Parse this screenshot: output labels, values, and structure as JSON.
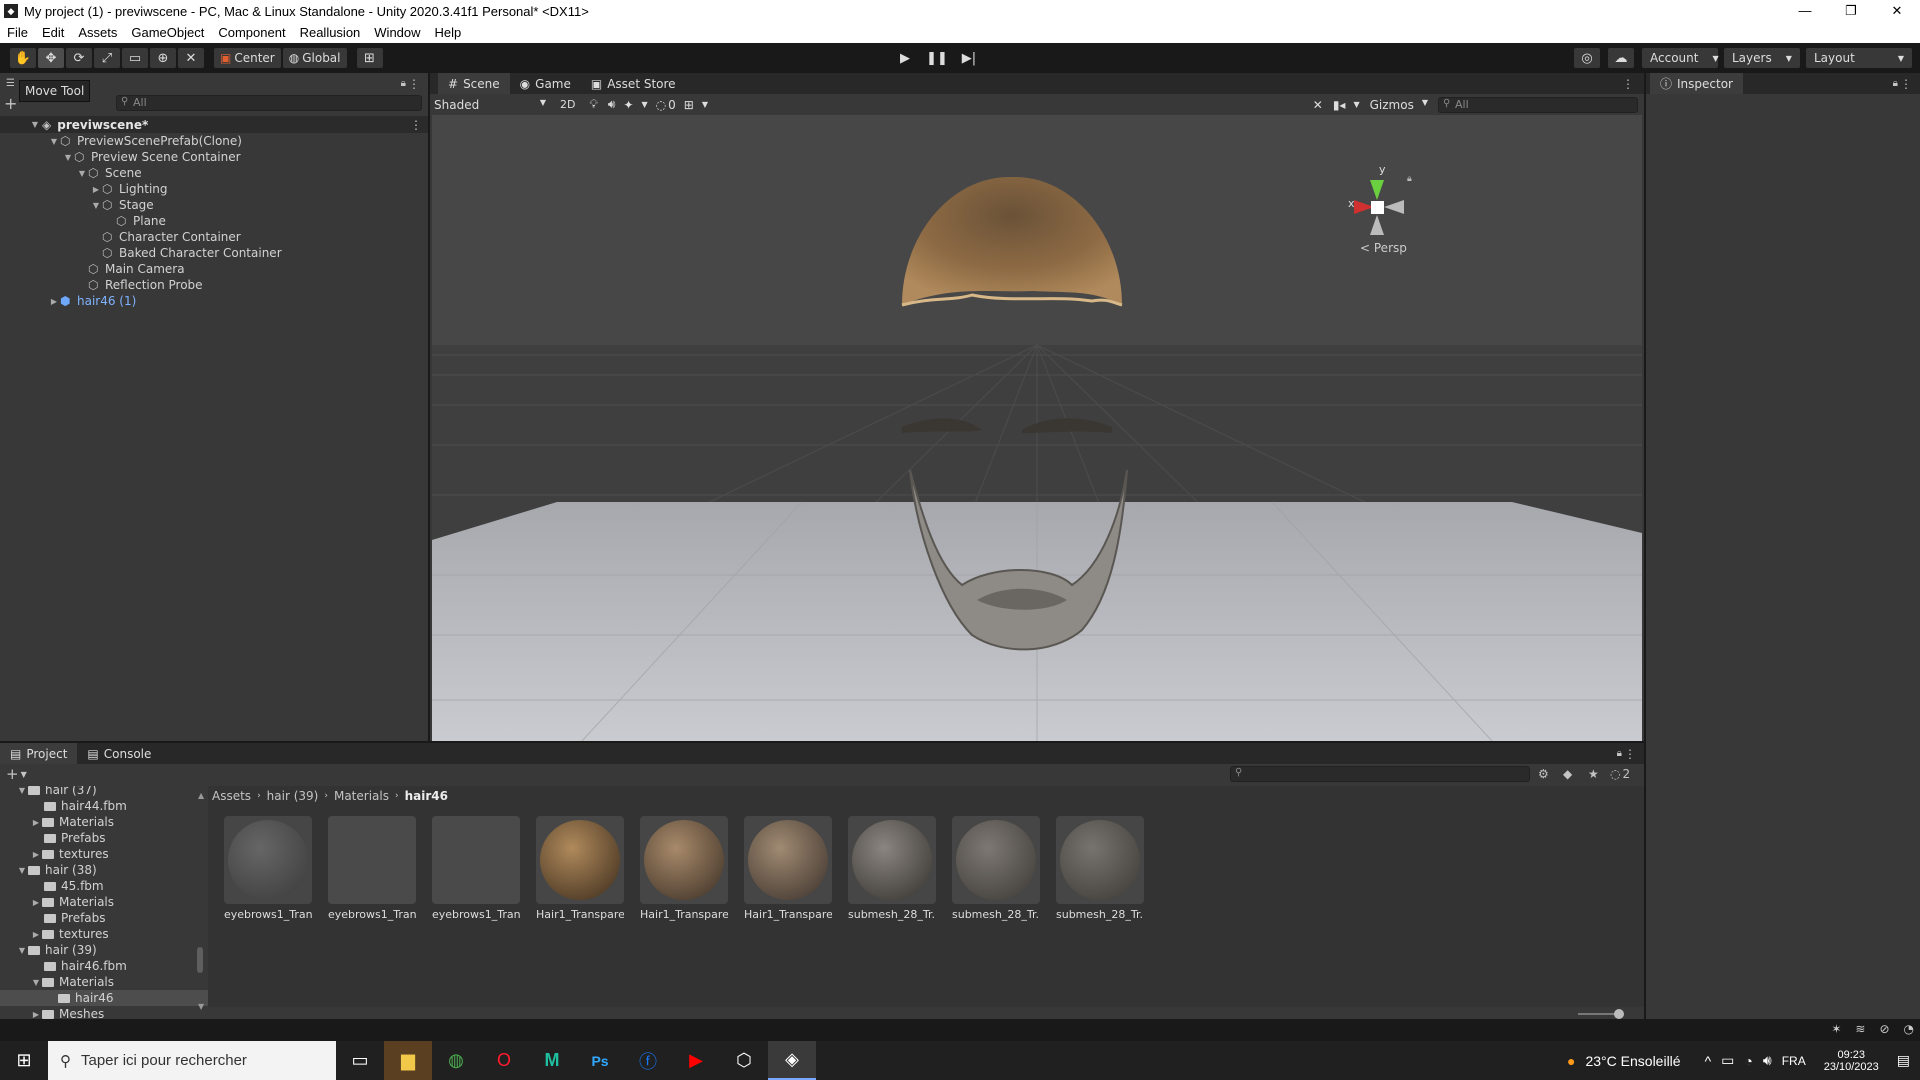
{
  "window": {
    "title": "My project (1) - previwscene - PC, Mac & Linux Standalone - Unity 2020.3.41f1 Personal* <DX11>"
  },
  "menu": [
    "File",
    "Edit",
    "Assets",
    "GameObject",
    "Component",
    "Reallusion",
    "Window",
    "Help"
  ],
  "toolbar": {
    "pivot": "Center",
    "space": "Global",
    "account": "Account",
    "layers": "Layers",
    "layout": "Layout",
    "tooltip": "Move Tool"
  },
  "hierarchy": {
    "search_placeholder": "All",
    "scene": "previwscene*",
    "items": [
      {
        "label": "PreviewScenePrefab(Clone)"
      },
      {
        "label": "Preview Scene Container"
      },
      {
        "label": "Scene"
      },
      {
        "label": "Lighting"
      },
      {
        "label": "Stage"
      },
      {
        "label": "Plane"
      },
      {
        "label": "Character Container"
      },
      {
        "label": "Baked Character Container"
      },
      {
        "label": "Main Camera"
      },
      {
        "label": "Reflection Probe"
      },
      {
        "label": "hair46 (1)"
      }
    ]
  },
  "scene_view": {
    "tabs": [
      "Scene",
      "Game",
      "Asset Store"
    ],
    "shading": "Shaded",
    "mode_2d": "2D",
    "hidden_count": "0",
    "gizmos": "Gizmos",
    "search_placeholder": "All",
    "axis_y": "y",
    "axis_x": "x",
    "projection": "Persp"
  },
  "inspector": {
    "title": "Inspector"
  },
  "project": {
    "tabs": [
      "Project",
      "Console"
    ],
    "hidden_count": "2",
    "tree": [
      {
        "label": "hair (37)"
      },
      {
        "label": "hair44.fbm"
      },
      {
        "label": "Materials"
      },
      {
        "label": "Prefabs"
      },
      {
        "label": "textures"
      },
      {
        "label": "hair (38)"
      },
      {
        "label": "45.fbm"
      },
      {
        "label": "Materials"
      },
      {
        "label": "Prefabs"
      },
      {
        "label": "textures"
      },
      {
        "label": "hair (39)"
      },
      {
        "label": "hair46.fbm"
      },
      {
        "label": "Materials"
      },
      {
        "label": "hair46"
      },
      {
        "label": "Meshes"
      }
    ],
    "breadcrumb": [
      "Assets",
      "hair (39)",
      "Materials",
      "hair46"
    ],
    "assets": [
      {
        "label": "eyebrows1_Tran..."
      },
      {
        "label": "eyebrows1_Tran..."
      },
      {
        "label": "eyebrows1_Tran..."
      },
      {
        "label": "Hair1_Transpare..."
      },
      {
        "label": "Hair1_Transpare..."
      },
      {
        "label": "Hair1_Transpare..."
      },
      {
        "label": "submesh_28_Tr..."
      },
      {
        "label": "submesh_28_Tr..."
      },
      {
        "label": "submesh_28_Tr..."
      }
    ]
  },
  "taskbar": {
    "search_placeholder": "Taper ici pour rechercher",
    "weather": "23°C  Ensoleillé",
    "language": "FRA",
    "time": "09:23",
    "date": "23/10/2023"
  }
}
